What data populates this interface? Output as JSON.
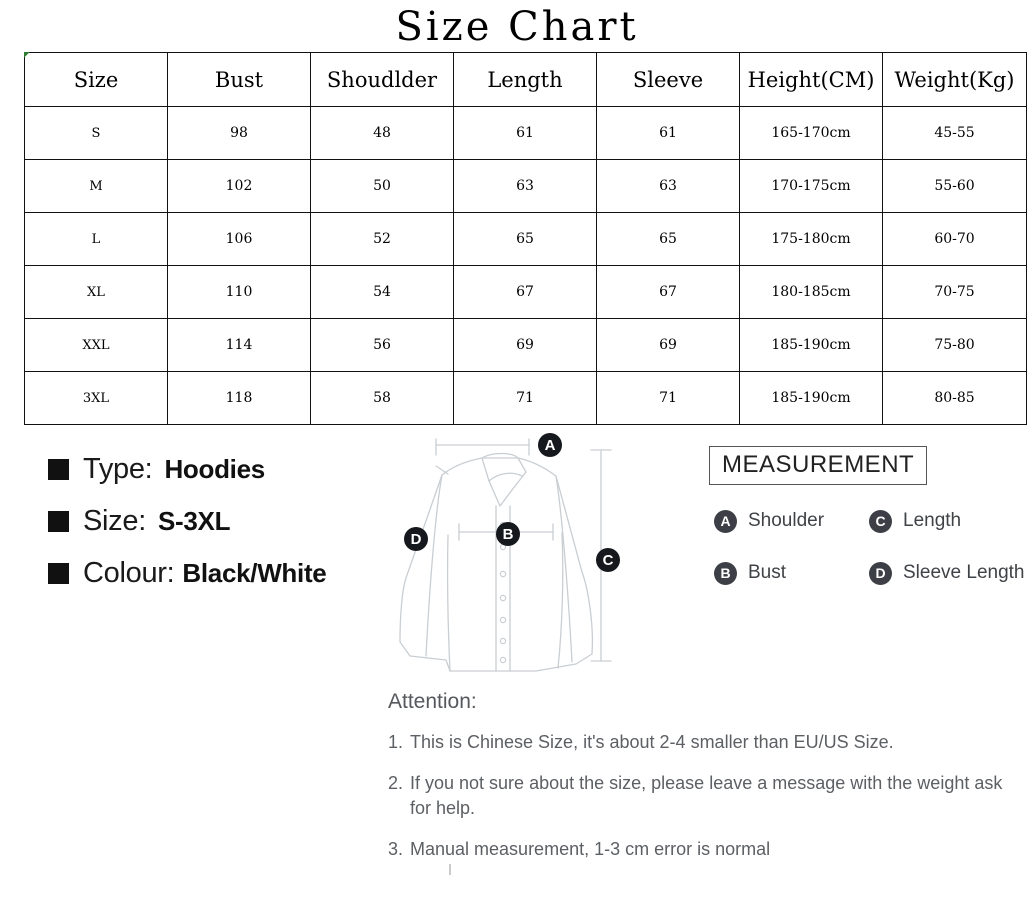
{
  "title": "Size Chart",
  "table": {
    "headers": [
      "Size",
      "Bust",
      "Shoudlder",
      "Length",
      "Sleeve",
      "Height(CM)",
      "Weight(Kg)"
    ],
    "rows": [
      [
        "S",
        "98",
        "48",
        "61",
        "61",
        "165-170cm",
        "45-55"
      ],
      [
        "M",
        "102",
        "50",
        "63",
        "63",
        "170-175cm",
        "55-60"
      ],
      [
        "L",
        "106",
        "52",
        "65",
        "65",
        "175-180cm",
        "60-70"
      ],
      [
        "XL",
        "110",
        "54",
        "67",
        "67",
        "180-185cm",
        "70-75"
      ],
      [
        "XXL",
        "114",
        "56",
        "69",
        "69",
        "185-190cm",
        "75-80"
      ],
      [
        "3XL",
        "118",
        "58",
        "71",
        "71",
        "185-190cm",
        "80-85"
      ]
    ]
  },
  "info": {
    "items": [
      {
        "label": "Type:",
        "value": "Hoodies"
      },
      {
        "label": "Size:",
        "value": "S-3XL"
      },
      {
        "label": "Colour:",
        "value": "Black/White"
      }
    ]
  },
  "diagram": {
    "markers": [
      {
        "id": "A",
        "meaning": "Shoulder"
      },
      {
        "id": "B",
        "meaning": "Bust"
      },
      {
        "id": "C",
        "meaning": "Length"
      },
      {
        "id": "D",
        "meaning": "Sleeve Length"
      }
    ],
    "garment_icon": "shirt-outline-icon",
    "outline_color": "#c9ced3",
    "marker_color": "#15181c"
  },
  "measurement": {
    "title": "MEASUREMENT",
    "legend": [
      {
        "key": "A",
        "label": "Shoulder"
      },
      {
        "key": "C",
        "label": "Length"
      },
      {
        "key": "B",
        "label": "Bust"
      },
      {
        "key": "D",
        "label": "Sleeve Length"
      }
    ],
    "circle_color": "#3c4046"
  },
  "attention": {
    "heading": "Attention:",
    "items": [
      {
        "num": "1.",
        "text": "This is Chinese Size, it's about 2-4 smaller than EU/US Size."
      },
      {
        "num": "2.",
        "text": "If you not sure about the size, please leave a message with the weight ask for help."
      },
      {
        "num": "3.",
        "text": "Manual measurement, 1-3 cm error is normal"
      }
    ]
  }
}
